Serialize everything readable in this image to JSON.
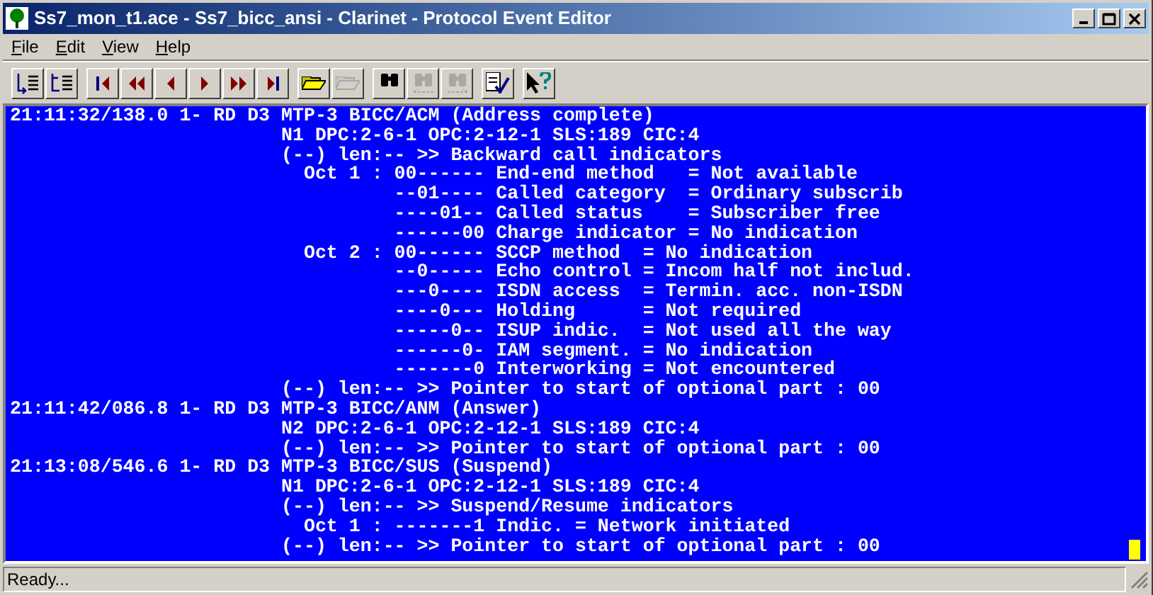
{
  "window": {
    "title": "Ss7_mon_t1.ace - Ss7_bicc_ansi - Clarinet - Protocol Event Editor"
  },
  "menu": [
    {
      "label": "File"
    },
    {
      "label": "Edit"
    },
    {
      "label": "View"
    },
    {
      "label": "Help"
    }
  ],
  "toolbar": [
    [
      {
        "kind": "expand",
        "disabled": false
      },
      {
        "kind": "collapse",
        "disabled": false
      }
    ],
    [
      {
        "kind": "first",
        "disabled": false
      },
      {
        "kind": "rewind",
        "disabled": false
      },
      {
        "kind": "prev",
        "disabled": false
      },
      {
        "kind": "next",
        "disabled": false
      },
      {
        "kind": "forward",
        "disabled": false
      },
      {
        "kind": "last",
        "disabled": false
      }
    ],
    [
      {
        "kind": "open",
        "disabled": false
      },
      {
        "kind": "open",
        "disabled": true
      }
    ],
    [
      {
        "kind": "find",
        "disabled": false
      },
      {
        "kind": "find-prev",
        "disabled": true
      },
      {
        "kind": "find-next",
        "disabled": true
      }
    ],
    [
      {
        "kind": "check",
        "disabled": false
      }
    ],
    [
      {
        "kind": "help",
        "disabled": false
      }
    ]
  ],
  "lines": [
    "21:11:32/138.0 1- RD D3 MTP-3 BICC/ACM (Address complete)",
    "                        N1 DPC:2-6-1 OPC:2-12-1 SLS:189 CIC:4",
    "                        (--) len:-- >> Backward call indicators",
    "                          Oct 1 : 00------ End-end method   = Not available",
    "                                  --01---- Called category  = Ordinary subscrib",
    "                                  ----01-- Called status    = Subscriber free",
    "                                  ------00 Charge indicator = No indication",
    "                          Oct 2 : 00------ SCCP method  = No indication",
    "                                  --0----- Echo control = Incom half not includ.",
    "                                  ---0---- ISDN access  = Termin. acc. non-ISDN",
    "                                  ----0--- Holding      = Not required",
    "                                  -----0-- ISUP indic.  = Not used all the way",
    "                                  ------0- IAM segment. = No indication",
    "                                  -------0 Interworking = Not encountered",
    "                        (--) len:-- >> Pointer to start of optional part : 00",
    "21:11:42/086.8 1- RD D3 MTP-3 BICC/ANM (Answer)",
    "                        N2 DPC:2-6-1 OPC:2-12-1 SLS:189 CIC:4",
    "                        (--) len:-- >> Pointer to start of optional part : 00",
    "21:13:08/546.6 1- RD D3 MTP-3 BICC/SUS (Suspend)",
    "                        N1 DPC:2-6-1 OPC:2-12-1 SLS:189 CIC:4",
    "                        (--) len:-- >> Suspend/Resume indicators",
    "                          Oct 1 : -------1 Indic. = Network initiated",
    "                        (--) len:-- >> Pointer to start of optional part : 00"
  ],
  "status_bar": "Ready..."
}
